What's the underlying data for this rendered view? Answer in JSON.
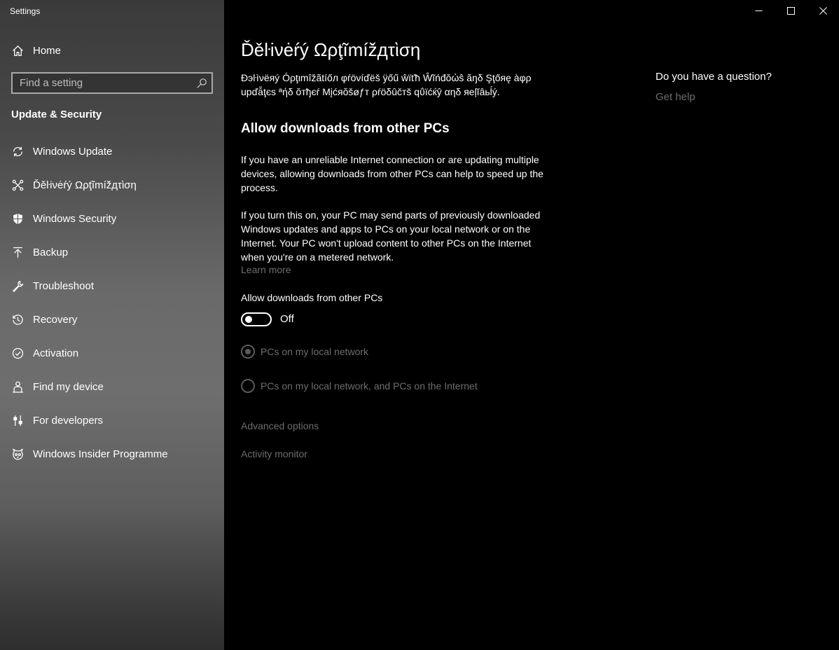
{
  "window": {
    "title": "Settings",
    "controls": [
      "minimize-icon",
      "maximize-icon",
      "close-icon"
    ]
  },
  "sidebar": {
    "home_label": "Home",
    "search": {
      "placeholder": "Find a setting",
      "icon": "search-icon"
    },
    "section_title": "Update & Security",
    "items": [
      {
        "label": "Windows Update",
        "icon": "refresh-icon"
      },
      {
        "label": "Ďěŀіνėŕý Ωρţĩmíž̌дτὶση",
        "icon": "delivery-optimization-icon"
      },
      {
        "label": "Windows Security",
        "icon": "shield-icon"
      },
      {
        "label": "Backup",
        "icon": "backup-arrow-icon"
      },
      {
        "label": "Troubleshoot",
        "icon": "wrench-icon"
      },
      {
        "label": "Recovery",
        "icon": "history-icon"
      },
      {
        "label": "Activation",
        "icon": "check-circle-icon"
      },
      {
        "label": "Find my device",
        "icon": "person-locate-icon"
      },
      {
        "label": "For developers",
        "icon": "developer-sliders-icon"
      },
      {
        "label": "Windows Insider Programme",
        "icon": "insider-cat-icon"
      }
    ]
  },
  "main": {
    "title": "Ďěŀіνėŕý Ωρţĩmíž̌дτὶση",
    "intro": "Ðэŀìνёяý Óρţιmîžãtíőл φŕöνíďёš ÿőű ŵïťħ Ŵĩńđŏώŝ ãŋδ Şţőяę àφρ upďẫţєѕ ªήδ ŏтђєŕ Mįćяŏšøƒт ρŕöδûčтš qΰïćќŷ αηδ яeļĭâьĺý.",
    "subheading": "Allow downloads from other PCs",
    "para1": "If you have an unreliable Internet connection or are updating multiple devices, allowing downloads from other PCs can help to speed up the process.",
    "para2": "If you turn this on, your PC may send parts of previously downloaded Windows updates and apps to PCs on your local network or on the Internet. Your PC won't upload content to other PCs on the Internet when you're on a metered network.",
    "learn_more": "Learn more",
    "toggle": {
      "label": "Allow downloads from other PCs",
      "state": "Off",
      "on": false
    },
    "radios": [
      {
        "label": "PCs on my local network",
        "selected": true,
        "enabled": false
      },
      {
        "label": "PCs on my local network, and PCs on the Internet",
        "selected": false,
        "enabled": false
      }
    ],
    "advanced_options": "Advanced options",
    "activity_monitor": "Activity monitor"
  },
  "aside": {
    "question": "Do you have a question?",
    "help_link": "Get help"
  },
  "colors": {
    "background": "#000000",
    "disabled_text": "#6d6d6d",
    "text": "#ffffff"
  }
}
